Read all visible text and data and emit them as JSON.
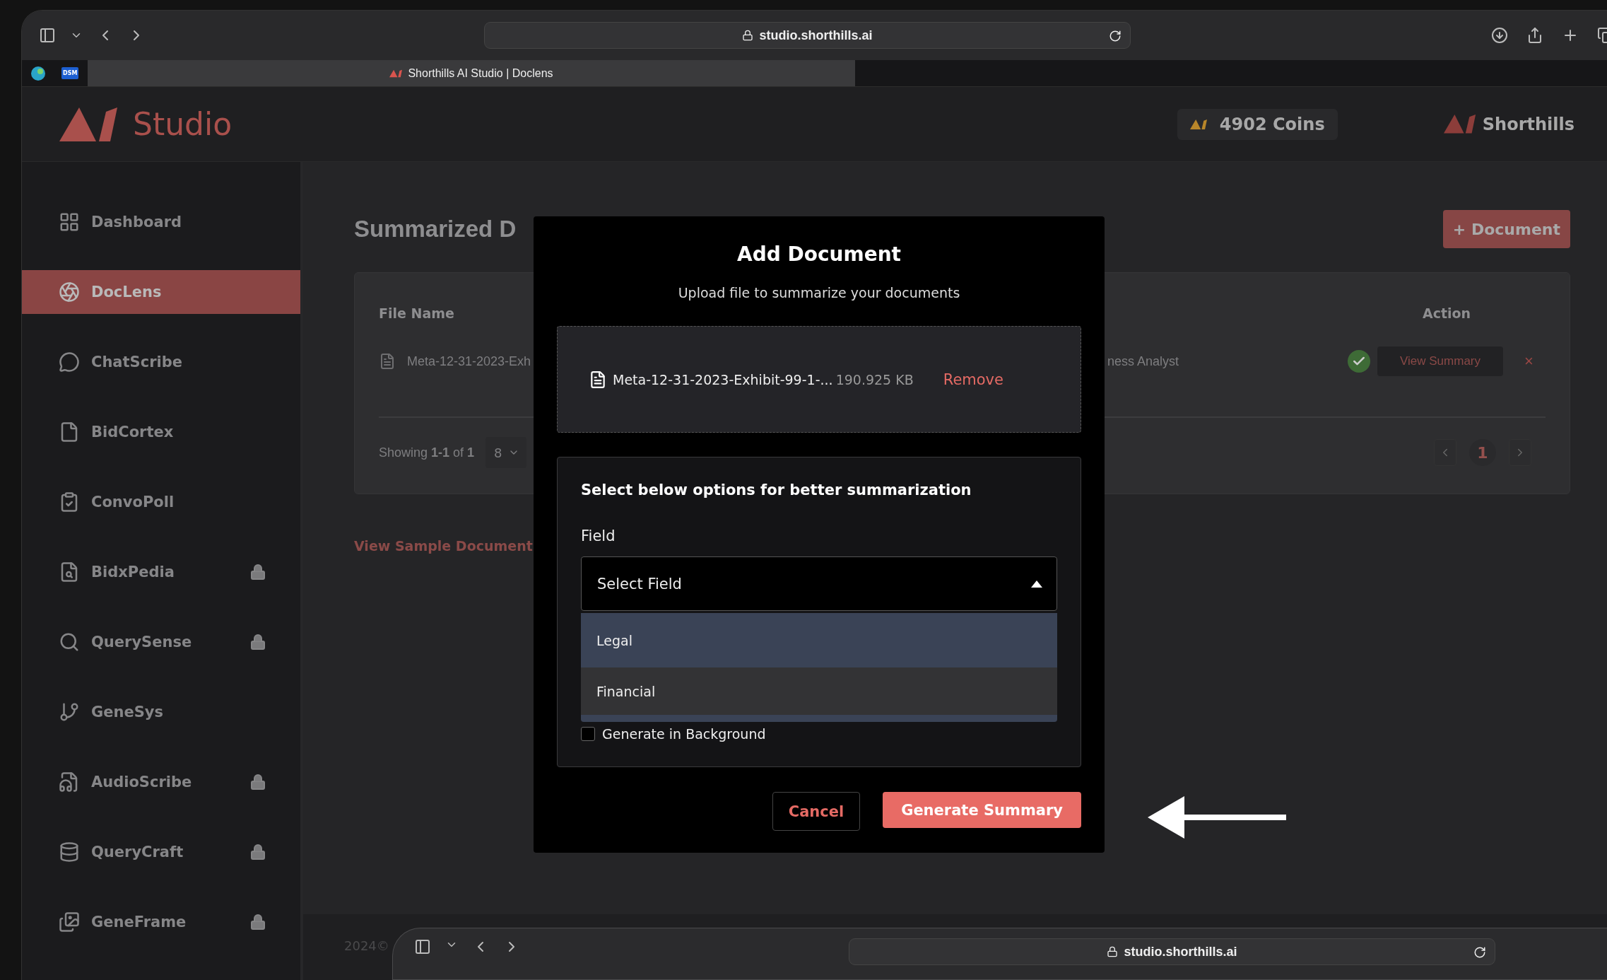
{
  "browser": {
    "url": "studio.shorthills.ai",
    "pinned_tabs": [
      {
        "kind": "logo"
      },
      {
        "kind": "badge",
        "label": "DSM"
      }
    ],
    "tab_title": "Shorthills AI Studio | Doclens"
  },
  "header": {
    "product": "Studio",
    "coins": "4902 Coins",
    "brand": "Shorthills"
  },
  "sidebar": {
    "items": [
      {
        "label": "Dashboard",
        "selected": false,
        "locked": false
      },
      {
        "label": "DocLens",
        "selected": true,
        "locked": false
      },
      {
        "label": "ChatScribe",
        "selected": false,
        "locked": false
      },
      {
        "label": "BidCortex",
        "selected": false,
        "locked": false
      },
      {
        "label": "ConvoPoll",
        "selected": false,
        "locked": false
      },
      {
        "label": "BidxPedia",
        "selected": false,
        "locked": true
      },
      {
        "label": "QuerySense",
        "selected": false,
        "locked": true
      },
      {
        "label": "GeneSys",
        "selected": false,
        "locked": false
      },
      {
        "label": "AudioScribe",
        "selected": false,
        "locked": true
      },
      {
        "label": "QueryCraft",
        "selected": false,
        "locked": true
      },
      {
        "label": "GeneFrame",
        "selected": false,
        "locked": true
      }
    ]
  },
  "page": {
    "title": "Summarized D",
    "add_button": "+ Document",
    "table": {
      "columns": [
        "File Name",
        "Action"
      ],
      "rows": [
        {
          "file": "Meta-12-31-2023-Exh",
          "column_2": "ness Analyst",
          "done": true,
          "action": "View Summary",
          "delete": "×"
        }
      ],
      "summary": "Showing **1-1** of **1**",
      "page_size": "8",
      "pages": [
        {
          "label": "1",
          "selected": true
        }
      ]
    },
    "sample_link": "View Sample Document",
    "footer": "2024©"
  },
  "modal": {
    "title": "Add Document",
    "subtitle": "Upload file to summarize your documents",
    "file": {
      "name": "Meta-12-31-2023-Exhibit-99-1-...",
      "size": "190.925 KB",
      "remove": "Remove"
    },
    "options_heading": "Select below options for better summarization",
    "field_label": "Field",
    "select": {
      "placeholder": "Select Field",
      "expanded": true,
      "options": [
        {
          "label": "Legal",
          "selected": true
        },
        {
          "label": "Financial",
          "selected": false
        }
      ]
    },
    "checkbox": {
      "label": "Generate in Background",
      "checked": false
    },
    "buttons": [
      {
        "label": "Cancel",
        "kind": "secondary"
      },
      {
        "label": "Generate Summary",
        "kind": "primary"
      }
    ]
  },
  "second_window": {
    "url": "studio.shorthills.ai"
  }
}
